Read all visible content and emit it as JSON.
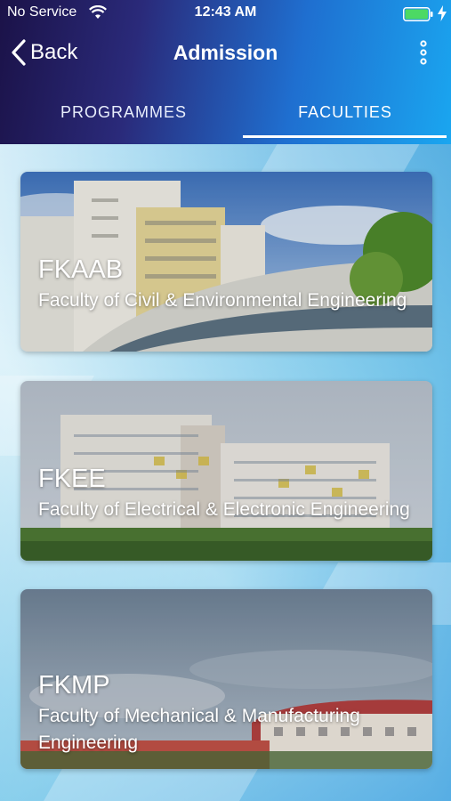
{
  "status_bar": {
    "carrier": "No Service",
    "time": "12:43 AM",
    "battery_color": "#4cd964"
  },
  "navbar": {
    "back_label": "Back",
    "title": "Admission",
    "back_icon": "chevron-left-icon",
    "menu_icon": "more-vertical-icon"
  },
  "tabs": [
    {
      "label": "PROGRAMMES",
      "active": false
    },
    {
      "label": "FACULTIES",
      "active": true
    }
  ],
  "faculties": [
    {
      "code": "FKAAB",
      "name": "Faculty of Civil & Environmental Engineering"
    },
    {
      "code": "FKEE",
      "name": "Faculty of Electrical & Electronic Engineering"
    },
    {
      "code": "FKMP",
      "name": "Faculty of Mechanical & Manufacturing Engineering"
    }
  ],
  "colors": {
    "header_start": "#1b1248",
    "header_end": "#1aa6f0",
    "tab_indicator": "#ffffff"
  }
}
